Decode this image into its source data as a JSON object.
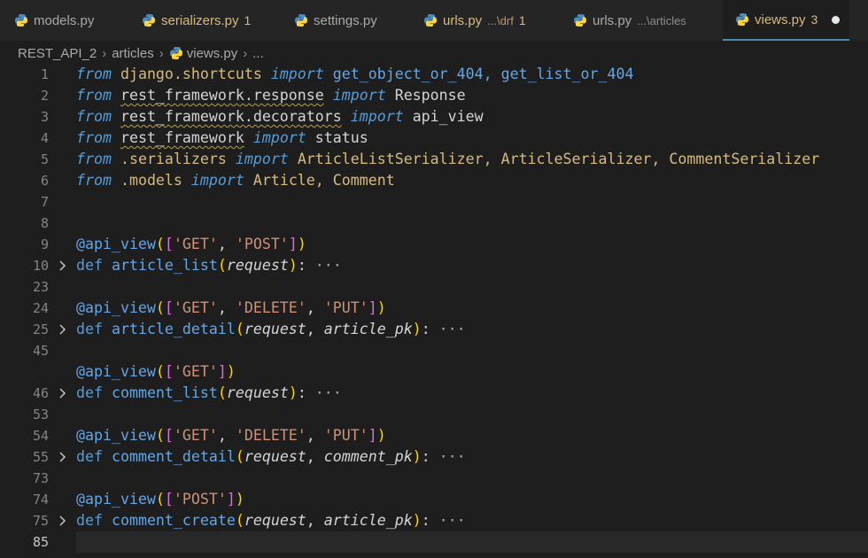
{
  "tabs": [
    {
      "label": "models.py",
      "desc": "",
      "badge": "",
      "state": "normal"
    },
    {
      "label": "serializers.py",
      "desc": "",
      "badge": "1",
      "state": "warn"
    },
    {
      "label": "settings.py",
      "desc": "",
      "badge": "",
      "state": "normal"
    },
    {
      "label": "urls.py",
      "desc": "...\\drf",
      "badge": "1",
      "state": "warn"
    },
    {
      "label": "urls.py",
      "desc": "...\\articles",
      "badge": "",
      "state": "normal"
    },
    {
      "label": "views.py",
      "desc": "",
      "badge": "3",
      "state": "active"
    }
  ],
  "breadcrumb": {
    "root": "REST_API_2",
    "folder": "articles",
    "file": "views.py",
    "more": "..."
  },
  "lines": {
    "l1": "1",
    "l2": "2",
    "l3": "3",
    "l4": "4",
    "l5": "5",
    "l6": "6",
    "l7": "7",
    "l8": "8",
    "l9": "9",
    "l10": "10",
    "l23": "23",
    "l24": "24",
    "l25": "25",
    "l45": "45",
    "l46": "46",
    "l53": "53",
    "l54": "54",
    "l55": "55",
    "l73": "73",
    "l74": "74",
    "l75": "75",
    "l85": "85"
  },
  "code": {
    "from": "from",
    "import": "import",
    "def": "def",
    "ellipsis": "···",
    "m1": "django.shortcuts",
    "n1": "get_object_or_404, get_list_or_404",
    "m2": "rest_framework.response",
    "n2": "Response",
    "m3": "rest_framework.decorators",
    "n3": "api_view",
    "m4": "rest_framework",
    "n4": "status",
    "m5": ".serializers",
    "n5": "ArticleListSerializer, ArticleSerializer, CommentSerializer",
    "m6": ".models",
    "n6": "Article, Comment",
    "deco": "@api_view",
    "get": "'GET'",
    "post": "'POST'",
    "delete": "'DELETE'",
    "put": "'PUT'",
    "f1": "article_list",
    "f2": "article_detail",
    "f3": "comment_list",
    "f4": "comment_detail",
    "f5": "comment_create",
    "request": "request",
    "article_pk": "article_pk",
    "comment_pk": "comment_pk"
  },
  "colors": {
    "accent": "#4e8aa6",
    "warning": "#d7ba7d",
    "keyword": "#569cd6"
  }
}
